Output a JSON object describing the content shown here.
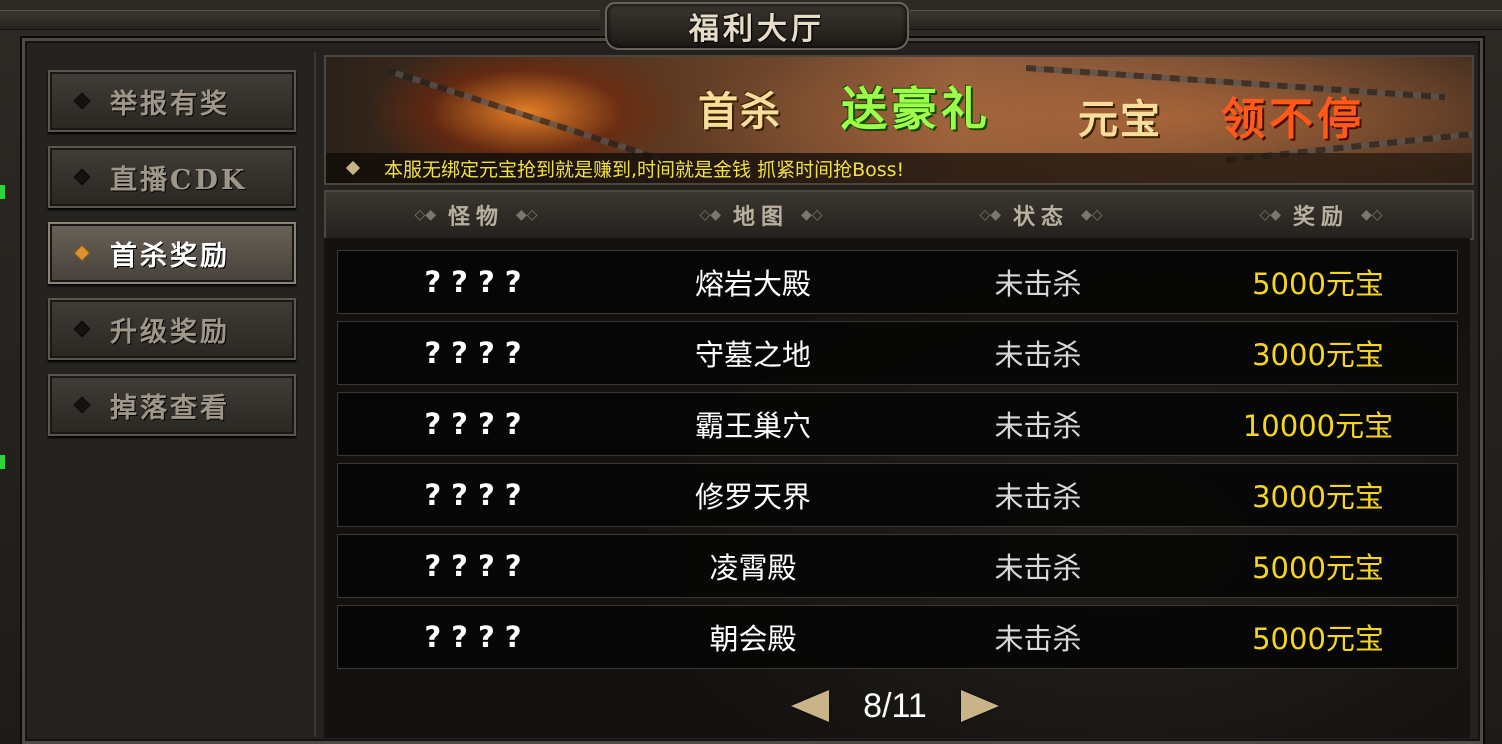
{
  "window": {
    "title": "福利大厅"
  },
  "sidebar": {
    "items": [
      {
        "label": "举报有奖",
        "active": false
      },
      {
        "label": "直播CDK",
        "active": false
      },
      {
        "label": "首杀奖励",
        "active": true
      },
      {
        "label": "升级奖励",
        "active": false
      },
      {
        "label": "掉落查看",
        "active": false
      }
    ]
  },
  "banner": {
    "part1": "首杀",
    "part2": "送豪礼",
    "part3": "元宝",
    "part4": "领不停",
    "notice": "本服无绑定元宝抢到就是赚到,时间就是金钱 抓紧时间抢Boss!"
  },
  "table": {
    "headers": [
      "怪物",
      "地图",
      "状态",
      "奖励"
    ],
    "rows": [
      {
        "monster": "????",
        "map": "熔岩大殿",
        "status": "未击杀",
        "reward": "5000元宝"
      },
      {
        "monster": "????",
        "map": "守墓之地",
        "status": "未击杀",
        "reward": "3000元宝"
      },
      {
        "monster": "????",
        "map": "霸王巢穴",
        "status": "未击杀",
        "reward": "10000元宝"
      },
      {
        "monster": "????",
        "map": "修罗天界",
        "status": "未击杀",
        "reward": "3000元宝"
      },
      {
        "monster": "????",
        "map": "凌霄殿",
        "status": "未击杀",
        "reward": "5000元宝"
      },
      {
        "monster": "????",
        "map": "朝会殿",
        "status": "未击杀",
        "reward": "5000元宝"
      }
    ]
  },
  "pager": {
    "label": "8/11"
  },
  "colors": {
    "reward": "#f5d51e",
    "active_marker": "#d8942e",
    "banner_green": "#9cff4a",
    "banner_red": "#ff5a1a"
  }
}
